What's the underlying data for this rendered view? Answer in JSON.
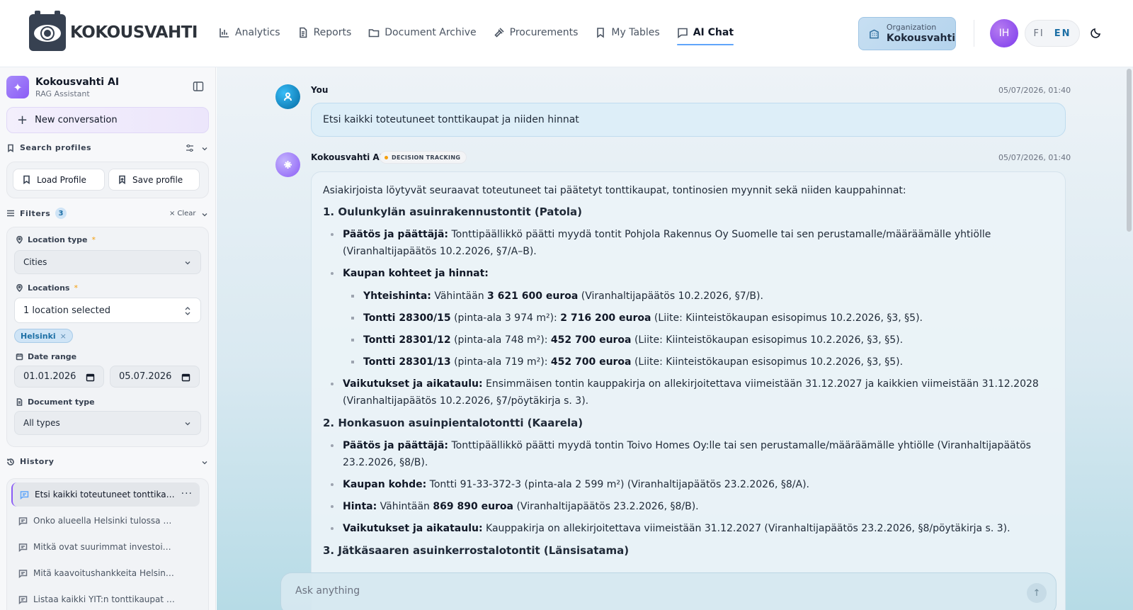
{
  "brand": {
    "name": "KOKOUSVAHTI"
  },
  "nav": [
    {
      "label": "Analytics",
      "icon": "bar-chart-icon",
      "active": false
    },
    {
      "label": "Reports",
      "icon": "document-icon",
      "active": false
    },
    {
      "label": "Document Archive",
      "icon": "folder-icon",
      "active": false
    },
    {
      "label": "Procurements",
      "icon": "gavel-icon",
      "active": false
    },
    {
      "label": "My Tables",
      "icon": "bookmark-icon",
      "active": false
    },
    {
      "label": "AI Chat",
      "icon": "chat-icon",
      "active": true
    }
  ],
  "org": {
    "label": "Organization",
    "value": "Kokousvahti"
  },
  "user": {
    "initials": "IH"
  },
  "lang": {
    "fi": "FI",
    "en": "EN",
    "selected": "EN"
  },
  "sidebar": {
    "title": "Kokousvahti AI",
    "subtitle": "RAG Assistant",
    "new_conversation": "New conversation",
    "search_profiles": {
      "title": "Search profiles",
      "load": "Load Profile",
      "save": "Save profile"
    },
    "filters": {
      "title": "Filters",
      "count": "3",
      "clear": "Clear",
      "location_type_label": "Location type",
      "location_type_value": "Cities",
      "locations_label": "Locations",
      "locations_value": "1 location selected",
      "location_chip": "Helsinki",
      "date_range_label": "Date range",
      "date_from": "01.01.2026",
      "date_to": "05.07.2026",
      "document_type_label": "Document type",
      "document_type_value": "All types",
      "required_mark": "*"
    },
    "history": {
      "title": "History",
      "items": [
        "Etsi kaikki toteutuneet tonttikaupat ja niiden hinnat",
        "Onko alueella Helsinki tulossa uusia hankkeita",
        "Mitkä ovat suurimmat investoinnit",
        "Mitä kaavoitushankkeita Helsingissä",
        "Listaa kaikki YIT:n tonttikaupat i..."
      ]
    }
  },
  "chat": {
    "user_message": {
      "author": "You",
      "time": "05/07/2026, 01:40",
      "text": "Etsi kaikki toteutuneet tonttikaupat ja niiden hinnat"
    },
    "ai_message": {
      "author": "Kokousvahti AI",
      "tag": "DECISION TRACKING",
      "time": "05/07/2026, 01:40",
      "intro": "Asiakirjoista löytyvät seuraavat toteutuneet tai päätetyt tonttikaupat, tontinosien myynnit sekä niiden kauppahinnat:",
      "s1_title": "1. Oulunkylän asuinrakennustontit (Patola)",
      "s1_b1_label": "Päätös ja päättäjä:",
      "s1_b1_text": " Tonttipäällikkö päätti myydä tontit Pohjola Rakennus Oy Suomelle tai sen perustamalle/määräämälle yhtiölle (Viranhaltijapäätös 10.2.2026, §7/A–B).",
      "s1_b2_label": "Kaupan kohteet ja hinnat:",
      "s1_sub1_label": "Yhteishinta:",
      "s1_sub1_pre": " Vähintään ",
      "s1_sub1_price": "3 621 600 euroa",
      "s1_sub1_post": " (Viranhaltijapäätös 10.2.2026, §7/B).",
      "s1_sub2_label": "Tontti 28300/15",
      "s1_sub2_pre": " (pinta-ala 3 974 m²): ",
      "s1_sub2_price": "2 716 200 euroa",
      "s1_sub2_post": " (Liite: Kiinteistökaupan esisopimus 10.2.2026, §3, §5).",
      "s1_sub3_label": "Tontti 28301/12",
      "s1_sub3_pre": " (pinta-ala 748 m²): ",
      "s1_sub3_price": "452 700 euroa",
      "s1_sub3_post": " (Liite: Kiinteistökaupan esisopimus 10.2.2026, §3, §5).",
      "s1_sub4_label": "Tontti 28301/13",
      "s1_sub4_pre": " (pinta-ala 719 m²): ",
      "s1_sub4_price": "452 700 euroa",
      "s1_sub4_post": " (Liite: Kiinteistökaupan esisopimus 10.2.2026, §3, §5).",
      "s1_b3_label": "Vaikutukset ja aikataulu:",
      "s1_b3_text": " Ensimmäisen tontin kauppakirja on allekirjoitettava viimeistään 31.12.2027 ja kaikkien viimeistään 31.12.2028 (Viranhaltijapäätös 10.2.2026, §7/pöytäkirja s. 3).",
      "s2_title": "2. Honkasuon asuinpientalotontti (Kaarela)",
      "s2_b1_label": "Päätös ja päättäjä:",
      "s2_b1_text": " Tonttipäällikkö päätti myydä tontin Toivo Homes Oy:lle tai sen perustamalle/määräämälle yhtiölle (Viranhaltijapäätös 23.2.2026, §8/B).",
      "s2_b2_label": "Kaupan kohde:",
      "s2_b2_text": " Tontti 91-33-372-3 (pinta-ala 2 599 m²) (Viranhaltijapäätös 23.2.2026, §8/A).",
      "s2_b3_label": "Hinta:",
      "s2_b3_pre": " Vähintään ",
      "s2_b3_price": "869 890 euroa",
      "s2_b3_post": " (Viranhaltijapäätös 23.2.2026, §8/B).",
      "s2_b4_label": "Vaikutukset ja aikataulu:",
      "s2_b4_text": " Kauppakirja on allekirjoitettava viimeistään 31.12.2027 (Viranhaltijapäätös 23.2.2026, §8/pöytäkirja s. 3).",
      "s3_title": "3. Jätkäsaaren asuinkerrostalotontit (Länsisatama)"
    },
    "composer": {
      "placeholder": "Ask anything"
    }
  }
}
